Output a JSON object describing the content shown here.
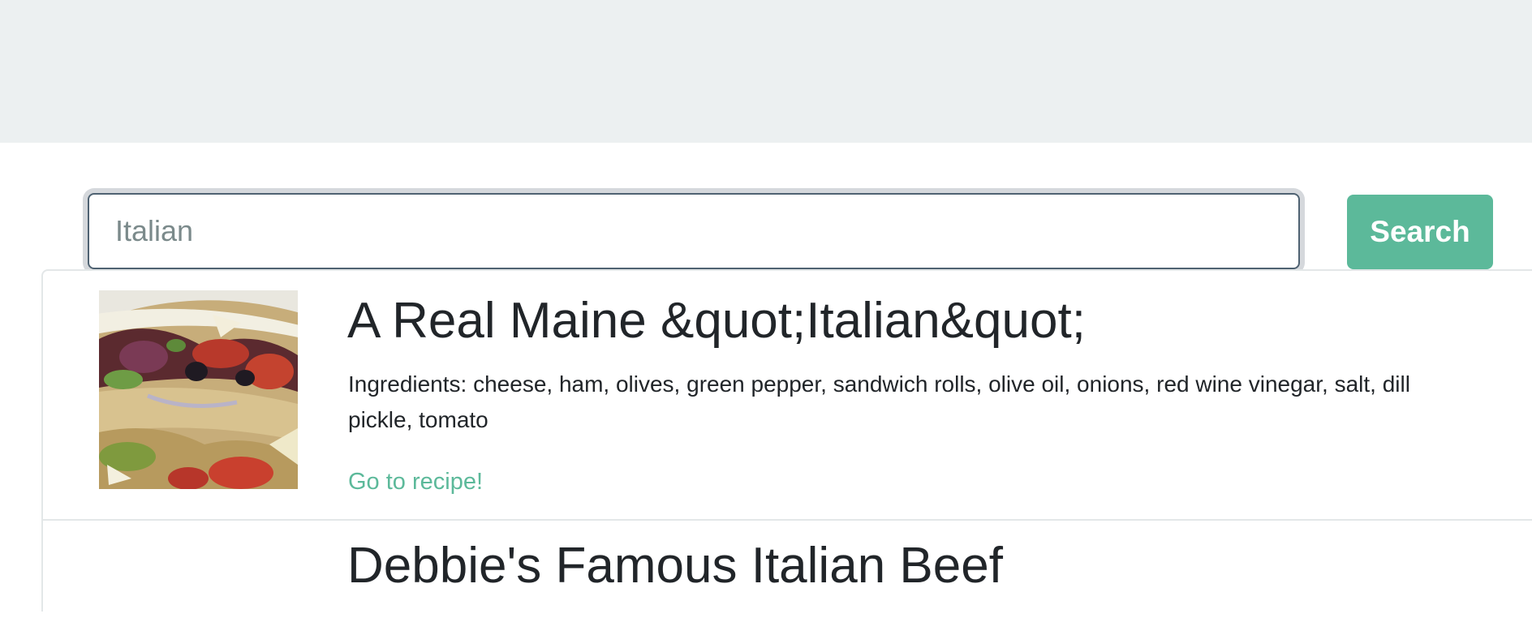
{
  "search": {
    "placeholder": "Italian",
    "value": "",
    "button_label": "Search"
  },
  "results": [
    {
      "title": "A Real Maine &quot;Italian&quot;",
      "ingredients": "Ingredients: cheese, ham, olives, green pepper, sandwich rolls, olive oil, onions, red wine vinegar, salt, dill pickle, tomato",
      "link_label": "Go to recipe!",
      "image": "sandwich-photo"
    },
    {
      "title": "Debbie's Famous Italian Beef"
    }
  ],
  "colors": {
    "accent": "#5cb99a",
    "header_band": "#ecf0f1",
    "text": "#212529",
    "input_border": "#4f6272"
  }
}
